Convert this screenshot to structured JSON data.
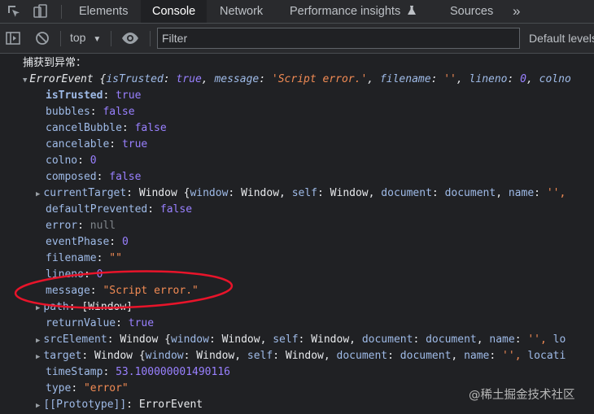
{
  "tabs": {
    "elements": "Elements",
    "console": "Console",
    "network": "Network",
    "performance": "Performance insights",
    "sources": "Sources",
    "more": "»"
  },
  "toolbar": {
    "context": "top",
    "filter_placeholder": "Filter",
    "levels": "Default levels"
  },
  "log": {
    "caught": "捕获到异常：",
    "summary": {
      "type": "ErrorEvent",
      "is_trusted_key": "isTrusted",
      "is_trusted_val": "true",
      "message_key": "message",
      "message_val": "'Script error.'",
      "filename_key": "filename",
      "filename_val": "''",
      "lineno_key": "lineno",
      "lineno_val": "0",
      "colno_key": "colno"
    },
    "props": {
      "is_trusted": {
        "key": "isTrusted",
        "val": "true"
      },
      "bubbles": {
        "key": "bubbles",
        "val": "false"
      },
      "cancel_bubble": {
        "key": "cancelBubble",
        "val": "false"
      },
      "cancelable": {
        "key": "cancelable",
        "val": "true"
      },
      "colno": {
        "key": "colno",
        "val": "0"
      },
      "composed": {
        "key": "composed",
        "val": "false"
      },
      "current_target": {
        "key": "currentTarget",
        "type": "Window",
        "win_k": "window",
        "win_v": "Window",
        "self_k": "self",
        "self_v": "Window",
        "doc_k": "document",
        "doc_v": "document",
        "name_k": "name",
        "name_v": "'',"
      },
      "default_prevented": {
        "key": "defaultPrevented",
        "val": "false"
      },
      "error": {
        "key": "error",
        "val": "null"
      },
      "event_phase": {
        "key": "eventPhase",
        "val": "0"
      },
      "filename": {
        "key": "filename",
        "val": "\"\""
      },
      "lineno": {
        "key": "lineno",
        "val": "0"
      },
      "message": {
        "key": "message",
        "val": "\"Script error.\""
      },
      "path": {
        "key": "path",
        "val": "[Window]"
      },
      "return_value": {
        "key": "returnValue",
        "val": "true"
      },
      "src_element": {
        "key": "srcElement",
        "type": "Window",
        "win_k": "window",
        "win_v": "Window",
        "self_k": "self",
        "self_v": "Window",
        "doc_k": "document",
        "doc_v": "document",
        "name_k": "name",
        "name_v": "'',",
        "tail": "lo"
      },
      "target": {
        "key": "target",
        "type": "Window",
        "win_k": "window",
        "win_v": "Window",
        "self_k": "self",
        "self_v": "Window",
        "doc_k": "document",
        "doc_v": "document",
        "name_k": "name",
        "name_v": "'',",
        "tail": "locati"
      },
      "time_stamp": {
        "key": "timeStamp",
        "val": "53.100000001490116"
      },
      "type": {
        "key": "type",
        "val": "\"error\""
      },
      "prototype": {
        "key": "[[Prototype]]",
        "val": "ErrorEvent"
      }
    }
  },
  "watermark": "@稀土掘金技术社区",
  "colors": {
    "bg": "#202124",
    "key": "#9fbbe8",
    "string": "#f28b54",
    "number": "#9980ff",
    "annotation": "#e8142a"
  }
}
